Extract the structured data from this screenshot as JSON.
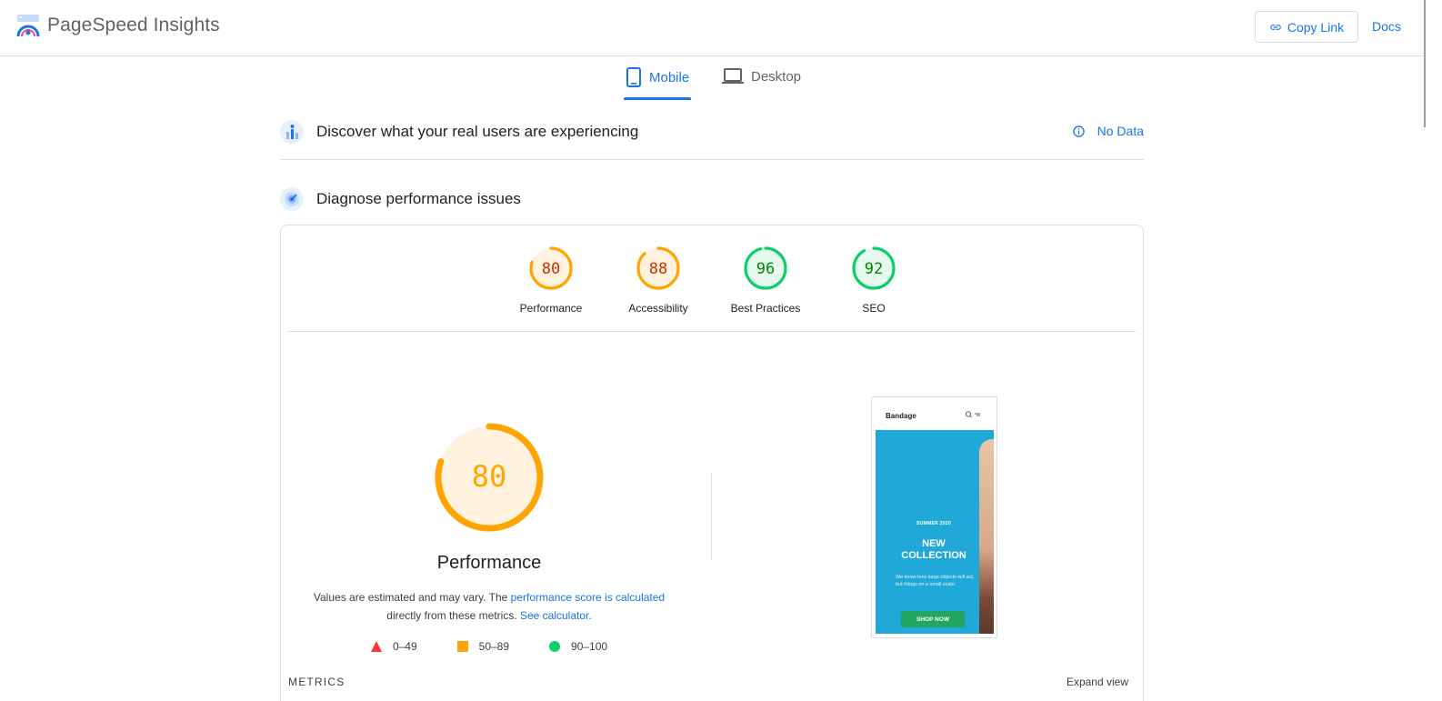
{
  "header": {
    "app_title": "PageSpeed Insights",
    "copy_link_label": "Copy Link",
    "docs_label": "Docs"
  },
  "tabs": [
    {
      "label": "Mobile",
      "active": true,
      "icon": "phone-icon"
    },
    {
      "label": "Desktop",
      "active": false,
      "icon": "laptop-icon"
    }
  ],
  "discover": {
    "title": "Discover what your real users are experiencing",
    "status": "No Data"
  },
  "diagnose": {
    "title": "Diagnose performance issues"
  },
  "scores": [
    {
      "label": "Performance",
      "value": "80",
      "level": "average"
    },
    {
      "label": "Accessibility",
      "value": "88",
      "level": "average"
    },
    {
      "label": "Best Practices",
      "value": "96",
      "level": "pass"
    },
    {
      "label": "SEO",
      "value": "92",
      "level": "pass"
    }
  ],
  "performance": {
    "score": "80",
    "title": "Performance",
    "desc_part1": "Values are estimated and may vary. The ",
    "link1": "performance score is calculated",
    "desc_part2": " directly from these metrics. ",
    "link2": "See calculator."
  },
  "legend": [
    {
      "range": "0–49",
      "shape": "triangle",
      "color": "#ff3333"
    },
    {
      "range": "50–89",
      "shape": "square",
      "color": "#ffa400"
    },
    {
      "range": "90–100",
      "shape": "circle",
      "color": "#0cce6b"
    }
  ],
  "screenshot": {
    "brand": "Bandage",
    "season": "SUMMER 2020",
    "headline_1": "NEW",
    "headline_2": "COLLECTION",
    "body": "We know how large objects will act, but things on a small scale.",
    "button": "SHOP NOW"
  },
  "metrics": {
    "label": "METRICS",
    "expand_label": "Expand view"
  },
  "colors": {
    "accent": "#1a73e8",
    "average": "#ffa400",
    "average_text": "#c33300",
    "pass": "#0cce6b",
    "pass_text": "#008800"
  }
}
